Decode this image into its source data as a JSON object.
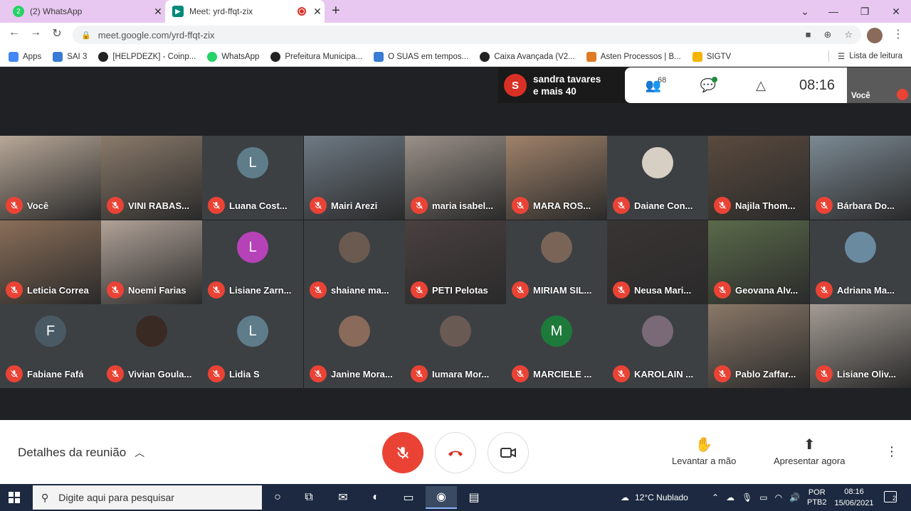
{
  "browser": {
    "tabs": [
      {
        "title": "(2) WhatsApp",
        "icon": "whatsapp-icon",
        "color": "#25d366"
      },
      {
        "title": "Meet: yrd-ffqt-zix",
        "icon": "meet-icon",
        "color": "#00897b"
      }
    ],
    "url": "meet.google.com/yrd-ffqt-zix",
    "bookmarks": [
      {
        "label": "Apps",
        "color": "#4285f4"
      },
      {
        "label": "SAI 3",
        "color": "#3a7bd5"
      },
      {
        "label": "[HELPDEZK] - Coinp...",
        "color": "#222222"
      },
      {
        "label": "WhatsApp",
        "color": "#25d366"
      },
      {
        "label": "Prefeitura Municipa...",
        "color": "#222222"
      },
      {
        "label": "O SUAS em tempos...",
        "color": "#3a7bd5"
      },
      {
        "label": "Caixa Avançada (V2...",
        "color": "#222222"
      },
      {
        "label": "Asten Processos | B...",
        "color": "#e07b25"
      },
      {
        "label": "SIGTV",
        "color": "#f4b400"
      }
    ],
    "reading_list": "Lista de leitura"
  },
  "meet": {
    "speaker": {
      "initial": "S",
      "line1": "sandra tavares",
      "line2": "e mais 40"
    },
    "participants_count": "68",
    "time": "08:16",
    "self_label": "Você",
    "tiles": [
      {
        "name": "Você",
        "type": "video",
        "bg": "#b8a898"
      },
      {
        "name": "VINI RABAS...",
        "type": "video",
        "bg": "#8a7a6a",
        "speaking": true
      },
      {
        "name": "Luana Cost...",
        "type": "avatar",
        "initial": "L",
        "avatar_color": "#5f7c8a"
      },
      {
        "name": "Mairi Arezi",
        "type": "video",
        "bg": "#6e7a84"
      },
      {
        "name": "maria isabel...",
        "type": "video",
        "bg": "#9a9088"
      },
      {
        "name": "MARA ROS...",
        "type": "video",
        "bg": "#a0826a"
      },
      {
        "name": "Daiane Con...",
        "type": "avatar",
        "initial": "",
        "avatar_color": "#d8cfc4"
      },
      {
        "name": "Najila Thom...",
        "type": "video",
        "bg": "#5a4a3e"
      },
      {
        "name": "Bárbara Do...",
        "type": "video",
        "bg": "#7c8a94"
      },
      {
        "name": "Leticia Correa",
        "type": "video",
        "bg": "#8a6e58"
      },
      {
        "name": "Noemi Farias",
        "type": "video",
        "bg": "#b0a298"
      },
      {
        "name": "Lisiane Zarn...",
        "type": "avatar",
        "initial": "L",
        "avatar_color": "#b642b8"
      },
      {
        "name": "shaiane ma...",
        "type": "avatar",
        "initial": "",
        "avatar_color": "#6a5a50"
      },
      {
        "name": "PETI Pelotas",
        "type": "video",
        "bg": "#4a4040"
      },
      {
        "name": "MIRIAM SIL...",
        "type": "avatar",
        "initial": "",
        "avatar_color": "#7a6458"
      },
      {
        "name": "Neusa Mari...",
        "type": "video",
        "bg": "#3a3434"
      },
      {
        "name": "Geovana Alv...",
        "type": "video",
        "bg": "#5a6a4a"
      },
      {
        "name": "Adriana Ma...",
        "type": "avatar",
        "initial": "",
        "avatar_color": "#6a8aa0"
      },
      {
        "name": "Fabiane Fafá",
        "type": "avatar",
        "initial": "F",
        "avatar_color": "#4a5a64"
      },
      {
        "name": "Vivian Goula...",
        "type": "avatar",
        "initial": "",
        "avatar_color": "#3a2a24"
      },
      {
        "name": "Lidia S",
        "type": "avatar",
        "initial": "L",
        "avatar_color": "#5f7c8a"
      },
      {
        "name": "Janine Mora...",
        "type": "avatar",
        "initial": "",
        "avatar_color": "#8a6a5a"
      },
      {
        "name": "Iumara Mor...",
        "type": "avatar",
        "initial": "",
        "avatar_color": "#6a5a54"
      },
      {
        "name": "MARCIELE ...",
        "type": "avatar",
        "initial": "M",
        "avatar_color": "#1e7a3a"
      },
      {
        "name": "KAROLAIN ...",
        "type": "avatar",
        "initial": "",
        "avatar_color": "#7a6a78"
      },
      {
        "name": "Pablo Zaffar...",
        "type": "video",
        "bg": "#8a7868"
      },
      {
        "name": "Lisiane Oliv...",
        "type": "video",
        "bg": "#a49c94"
      }
    ]
  },
  "controls": {
    "details": "Detalhes da reunião",
    "raise_hand": "Levantar a mão",
    "present": "Apresentar agora"
  },
  "taskbar": {
    "search_placeholder": "Digite aqui para pesquisar",
    "weather": "12°C  Nublado",
    "lang1": "POR",
    "lang2": "PTB2",
    "time": "08:16",
    "date": "15/06/2021",
    "notifications": "2"
  }
}
